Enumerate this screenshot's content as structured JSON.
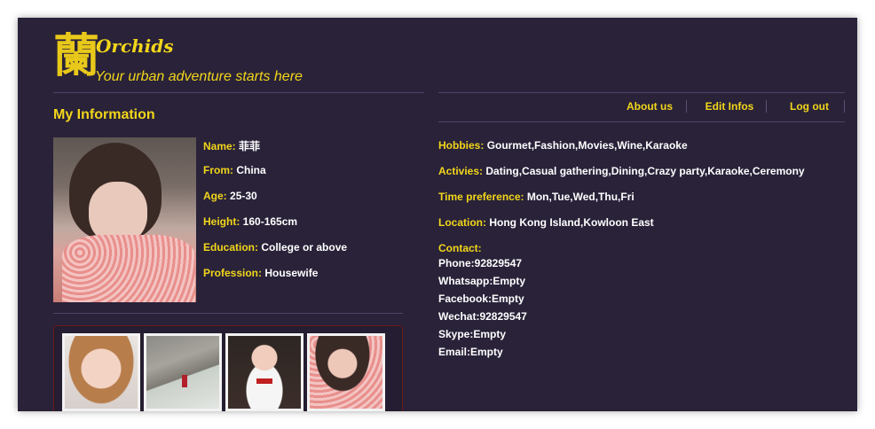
{
  "header": {
    "logo_glyph": "蘭",
    "title": "Orchids",
    "tagline": "Your urban adventure starts here"
  },
  "nav": {
    "about": "About us",
    "edit": "Edit Infos",
    "logout": "Log out"
  },
  "section_title": "My Information",
  "profile": {
    "name_label": "Name:",
    "name": "菲菲",
    "from_label": "From:",
    "from": "China",
    "age_label": "Age:",
    "age": "25-30",
    "height_label": "Height:",
    "height": "160-165cm",
    "education_label": "Education:",
    "education": "College or above",
    "profession_label": "Profession:",
    "profession": "Housewife"
  },
  "details": {
    "hobbies_label": "Hobbies:",
    "hobbies": "Gourmet,Fashion,Movies,Wine,Karaoke",
    "activities_label": "Activies:",
    "activities": "Dating,Casual gathering,Dining,Crazy party,Karaoke,Ceremony",
    "time_label": "Time preference:",
    "time": "Mon,Tue,Wed,Thu,Fri",
    "location_label": "Location:",
    "location": "Hong Kong Island,Kowloon East"
  },
  "contact": {
    "label": "Contact:",
    "phone": "Phone:92829547",
    "whatsapp": "Whatsapp:Empty",
    "facebook": "Facebook:Empty",
    "wechat": "Wechat:92829547",
    "skype": "Skype:Empty",
    "email": "Email:Empty"
  },
  "colors": {
    "background": "#292239",
    "accent": "#f2d61a",
    "text": "#ffffff"
  }
}
